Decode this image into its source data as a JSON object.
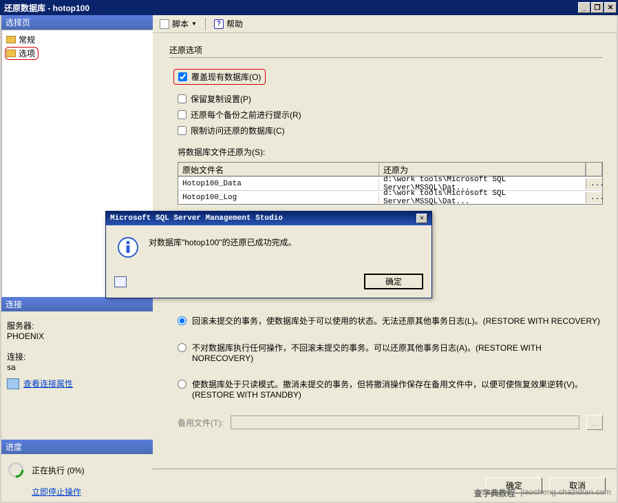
{
  "window": {
    "title": "还原数据库 - hotop100",
    "min_label": "_",
    "restore_label": "❐",
    "close_label": "✕"
  },
  "sidebar": {
    "pages_header": "选择页",
    "items": [
      {
        "label": "常规"
      },
      {
        "label": "选项"
      }
    ],
    "connection_header": "连接",
    "server_label": "服务器:",
    "server_value": "PHOENIX",
    "conn_label": "连接:",
    "conn_value": "sa",
    "view_props": "查看连接属性",
    "progress_header": "进度",
    "progress_text": "正在执行 (0%)",
    "stop_text": "立即停止操作"
  },
  "toolbar": {
    "script_label": "脚本",
    "help_label": "帮助",
    "help_glyph": "?"
  },
  "main": {
    "restore_options_title": "还原选项",
    "chk_overwrite": "覆盖现有数据库(O)",
    "chk_keep_replication": "保留复制设置(P)",
    "chk_prompt_each": "还原每个备份之前进行提示(R)",
    "chk_restrict": "限制访问还原的数据库(C)",
    "files_label": "将数据库文件还原为(S):",
    "grid": {
      "headers": [
        "原始文件名",
        "还原为"
      ],
      "rows": [
        {
          "name": "Hotop100_Data",
          "path": "d:\\work tools\\Microsoft SQL Server\\MSSQL\\Dat...",
          "btn": "..."
        },
        {
          "name": "Hotop100_Log",
          "path": "d:\\work tools\\Microsoft SQL Server\\MSSQL\\Dat...",
          "btn": "..."
        }
      ]
    },
    "radios": {
      "r1": "回滚未提交的事务，使数据库处于可以使用的状态。无法还原其他事务日志(L)。(RESTORE WITH RECOVERY)",
      "r2": "不对数据库执行任何操作，不回滚未提交的事务。可以还原其他事务日志(A)。(RESTORE WITH NORECOVERY)",
      "r3": "使数据库处于只读模式。撤消未提交的事务，但将撤消操作保存在备用文件中，以便可使恢复效果逆转(V)。(RESTORE WITH STANDBY)"
    },
    "backup_file_label": "备用文件(T):",
    "browse_btn": "..."
  },
  "footer": {
    "ok": "确定",
    "cancel": "取消"
  },
  "dialog": {
    "title": "Microsoft SQL Server Management Studio",
    "message": "对数据库\"hotop100\"的还原已成功完成。",
    "ok": "确定",
    "close": "✕"
  },
  "watermark": {
    "site1": "查字典教程",
    "site2": "jiaocheng.chazidian.com"
  }
}
